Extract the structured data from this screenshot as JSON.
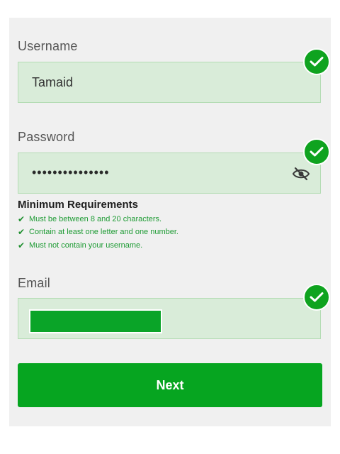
{
  "form": {
    "username": {
      "label": "Username",
      "value": "Tamaid",
      "valid": true
    },
    "password": {
      "label": "Password",
      "masked_value": "•••••••••••••••",
      "valid": true,
      "toggle_icon": "eye-slash-icon"
    },
    "requirements": {
      "title": "Minimum Requirements",
      "items": [
        {
          "check": "✔",
          "text": "Must be between 8 and 20 characters."
        },
        {
          "check": "✔",
          "text": "Contain at least one letter and one number."
        },
        {
          "check": "✔",
          "text": "Must not contain your username."
        }
      ]
    },
    "email": {
      "label": "Email",
      "valid": true,
      "value_redacted": true
    },
    "next_label": "Next"
  },
  "colors": {
    "accent_green": "#06a520",
    "field_bg": "#d9ecd9",
    "requirement_text": "#1e9b34"
  }
}
